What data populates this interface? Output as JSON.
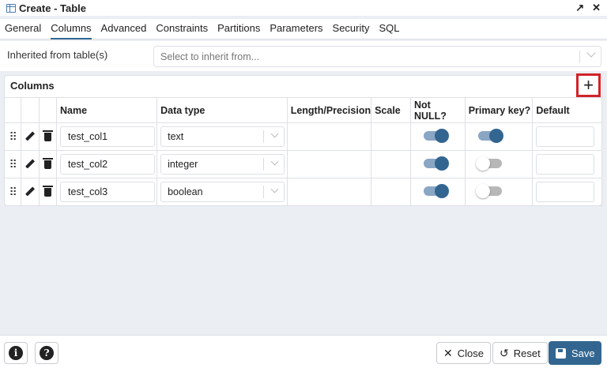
{
  "window": {
    "title": "Create - Table",
    "expand_icon": "↗",
    "close_icon": "✕"
  },
  "tabs": [
    {
      "label": "General"
    },
    {
      "label": "Columns",
      "active": true
    },
    {
      "label": "Advanced"
    },
    {
      "label": "Constraints"
    },
    {
      "label": "Partitions"
    },
    {
      "label": "Parameters"
    },
    {
      "label": "Security"
    },
    {
      "label": "SQL"
    }
  ],
  "inherit": {
    "label": "Inherited from table(s)",
    "placeholder": "Select to inherit from..."
  },
  "columns_panel": {
    "title": "Columns",
    "add_label": "+",
    "headers": [
      "Name",
      "Data type",
      "Length/Precision",
      "Scale",
      "Not NULL?",
      "Primary key?",
      "Default"
    ],
    "rows": [
      {
        "name": "test_col1",
        "data_type": "text",
        "not_null": true,
        "primary_key": true
      },
      {
        "name": "test_col2",
        "data_type": "integer",
        "not_null": true,
        "primary_key": false
      },
      {
        "name": "test_col3",
        "data_type": "boolean",
        "not_null": true,
        "primary_key": false
      }
    ]
  },
  "footer": {
    "info_label": "i",
    "help_label": "?",
    "close_label": "Close",
    "reset_label": "Reset",
    "save_label": "Save"
  },
  "colors": {
    "accent": "#326690",
    "highlight": "#d2232a"
  }
}
